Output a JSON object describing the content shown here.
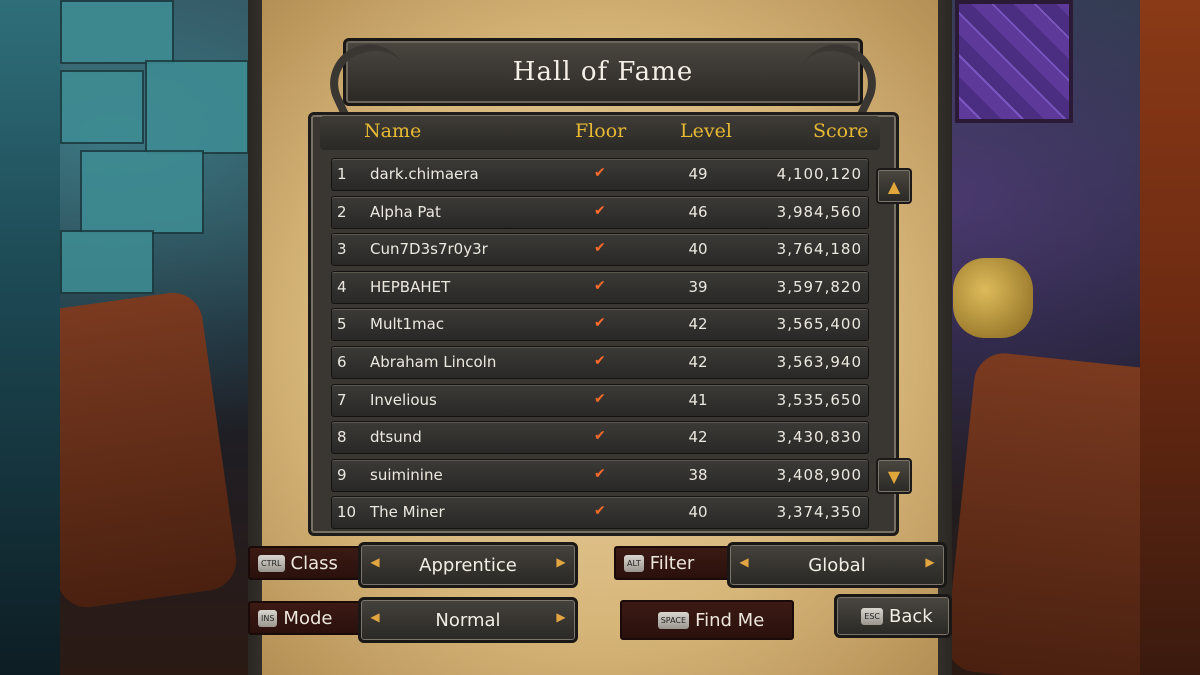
{
  "title": "Hall of Fame",
  "columns": {
    "name": "Name",
    "floor": "Floor",
    "level": "Level",
    "score": "Score"
  },
  "rows": [
    {
      "rank": "1",
      "name": "dark.chimaera",
      "floor": "✔",
      "level": "49",
      "score": "4,100,120"
    },
    {
      "rank": "2",
      "name": "Alpha Pat",
      "floor": "✔",
      "level": "46",
      "score": "3,984,560"
    },
    {
      "rank": "3",
      "name": "Cun7D3s7r0y3r",
      "floor": "✔",
      "level": "40",
      "score": "3,764,180"
    },
    {
      "rank": "4",
      "name": "НЕРВАНЕТ",
      "floor": "✔",
      "level": "39",
      "score": "3,597,820"
    },
    {
      "rank": "5",
      "name": "Mult1mac",
      "floor": "✔",
      "level": "42",
      "score": "3,565,400"
    },
    {
      "rank": "6",
      "name": "Abraham Lincoln",
      "floor": "✔",
      "level": "42",
      "score": "3,563,940"
    },
    {
      "rank": "7",
      "name": "Invelious",
      "floor": "✔",
      "level": "41",
      "score": "3,535,650"
    },
    {
      "rank": "8",
      "name": "dtsund",
      "floor": "✔",
      "level": "42",
      "score": "3,430,830"
    },
    {
      "rank": "9",
      "name": "suiminine",
      "floor": "✔",
      "level": "38",
      "score": "3,408,900"
    },
    {
      "rank": "10",
      "name": "The Miner",
      "floor": "✔",
      "level": "40",
      "score": "3,374,350"
    }
  ],
  "scroll": {
    "up": "▲",
    "down": "▼"
  },
  "controls": {
    "class": {
      "key": "CTRL",
      "label": "Class",
      "value": "Apprentice"
    },
    "filter": {
      "key": "ALT",
      "label": "Filter",
      "value": "Global"
    },
    "mode": {
      "key": "INS",
      "label": "Mode",
      "value": "Normal"
    },
    "find_me": {
      "key": "SPACE",
      "label": "Find Me"
    },
    "back": {
      "key": "ESC",
      "label": "Back"
    }
  },
  "arrows": {
    "left": "◀",
    "right": "▶"
  },
  "colors": {
    "header_gold": "#e7b934",
    "check_orange": "#ff6a2a",
    "parchment": "#e9d3a3"
  }
}
